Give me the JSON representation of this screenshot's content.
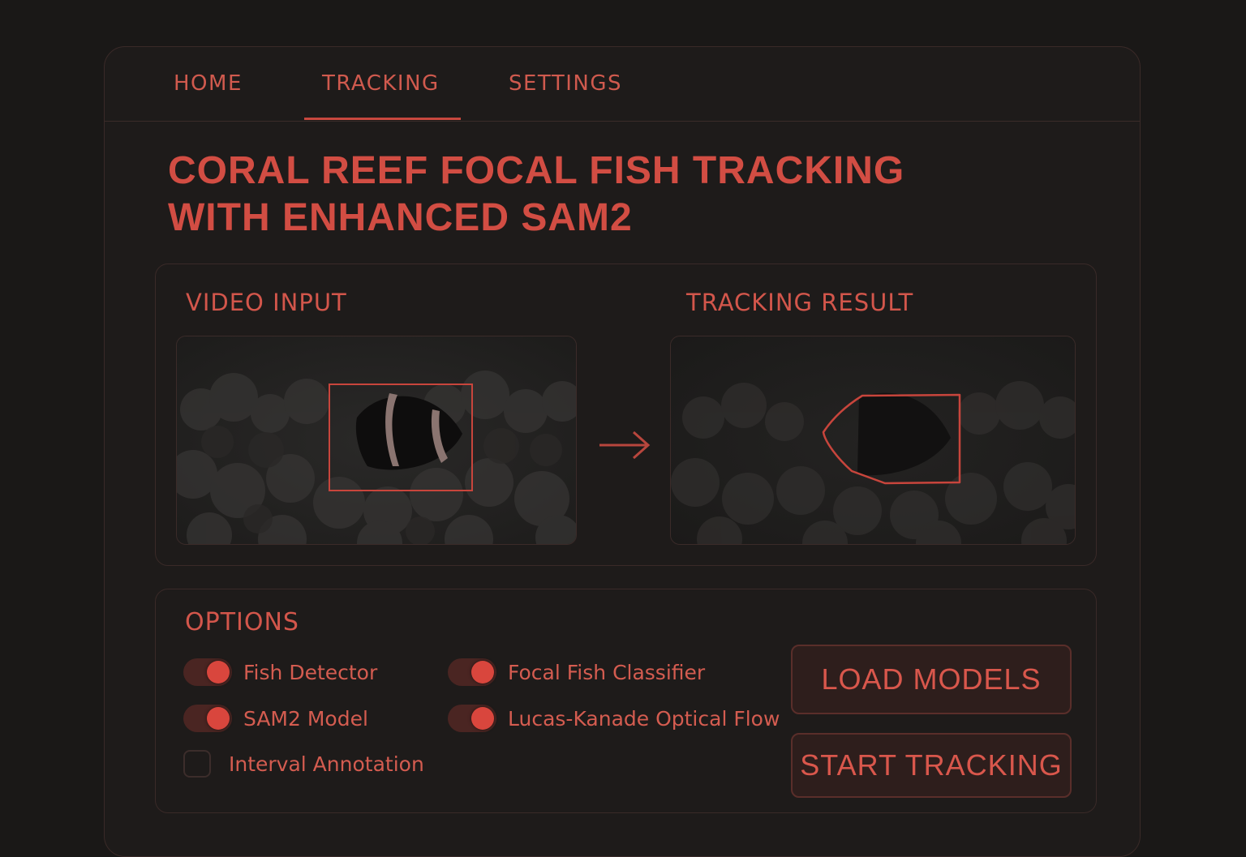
{
  "nav": {
    "tabs": [
      {
        "label": "HOME",
        "active": false
      },
      {
        "label": "TRACKING",
        "active": true
      },
      {
        "label": "SETTINGS",
        "active": false
      }
    ]
  },
  "page": {
    "title_line1": "CORAL REEF FOCAL FISH TRACKING",
    "title_line2": "WITH ENHANCED SAM2"
  },
  "video": {
    "input_label": "VIDEO INPUT",
    "result_label": "TRACKING RESULT"
  },
  "options": {
    "heading": "OPTIONS",
    "toggles": [
      {
        "label": "Fish Detector",
        "enabled": true
      },
      {
        "label": "Focal Fish Classifier",
        "enabled": true
      },
      {
        "label": "SAM2 Model",
        "enabled": true
      },
      {
        "label": "Lucas-Kanade Optical Flow",
        "enabled": true
      }
    ],
    "checkbox": {
      "label": "Interval Annotation",
      "checked": false
    }
  },
  "buttons": {
    "load_models": "LOAD MODELS",
    "start_tracking": "START TRACKING"
  },
  "colors": {
    "accent": "#d24d43",
    "background": "#1a1817",
    "panel": "#1e1b1a",
    "border": "#3a2a28"
  }
}
